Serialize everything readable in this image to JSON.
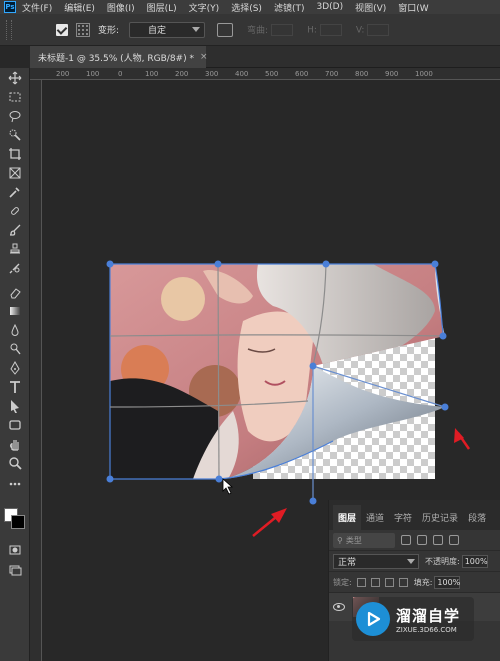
{
  "app": {
    "name": "Photoshop",
    "logo_text": "Ps"
  },
  "menu": [
    "文件(F)",
    "编辑(E)",
    "图像(I)",
    "图层(L)",
    "文字(Y)",
    "选择(S)",
    "滤镜(T)",
    "3D(D)",
    "视图(V)",
    "窗口(W"
  ],
  "options": {
    "transform_label": "变形:",
    "transform_value": "自定",
    "bend_label": "弯曲:",
    "h_label": "H:",
    "v_label": "V:"
  },
  "document": {
    "tab_title": "未标题-1 @ 35.5% (人物, RGB/8#) *",
    "close_glyph": "×"
  },
  "ruler": {
    "h_ticks": [
      "200",
      "100",
      "0",
      "100",
      "200",
      "300",
      "400",
      "500",
      "600",
      "700",
      "800",
      "900",
      "1000"
    ]
  },
  "layers_panel": {
    "tabs": [
      "图层",
      "通道",
      "字符",
      "历史记录",
      "段落"
    ],
    "active_tab": "图层",
    "filter_placeholder": "类型",
    "blend_mode": "正常",
    "opacity_label": "不透明度:",
    "opacity_value": "100%",
    "lock_label": "锁定:",
    "fill_label": "填充:",
    "fill_value": "100%"
  },
  "watermark": {
    "title": "溜溜自学",
    "url": "ZIXUE.3D66.COM"
  },
  "colors": {
    "accent": "#4a7fd8",
    "arrow": "#e01c24",
    "canvas_bg": "#282828"
  }
}
